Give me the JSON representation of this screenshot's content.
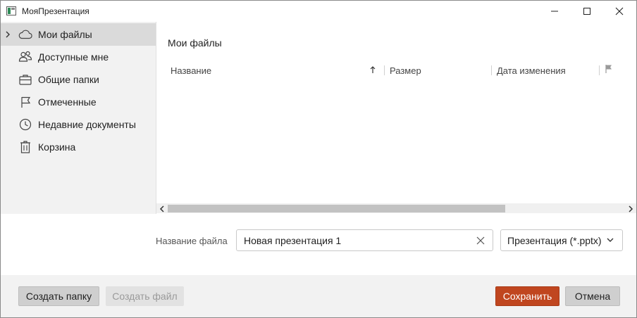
{
  "window": {
    "title": "МояПрезентация",
    "icons": {
      "app": "window-app-icon",
      "minimize": "minimize-icon",
      "maximize": "maximize-icon",
      "close": "close-icon"
    }
  },
  "sidebar": {
    "items": [
      {
        "label": "Мои файлы",
        "icon": "cloud-icon",
        "selected": true,
        "expandable": true
      },
      {
        "label": "Доступные мне",
        "icon": "people-icon",
        "selected": false
      },
      {
        "label": "Общие папки",
        "icon": "briefcase-icon",
        "selected": false
      },
      {
        "label": "Отмеченные",
        "icon": "flag-icon",
        "selected": false
      },
      {
        "label": "Недавние документы",
        "icon": "clock-icon",
        "selected": false
      },
      {
        "label": "Корзина",
        "icon": "trash-icon",
        "selected": false
      }
    ]
  },
  "main": {
    "title": "Мои файлы",
    "columns": [
      {
        "label": "Название",
        "sorted": "ascending"
      },
      {
        "label": "Размер"
      },
      {
        "label": "Дата изменения"
      },
      {
        "label": "",
        "icon": "flag-icon"
      }
    ],
    "rows": []
  },
  "scrollbar": {
    "position": 0
  },
  "file": {
    "name_label": "Название файла",
    "name_value": "Новая презентация 1",
    "type_value": "Презентация (*.pptx)"
  },
  "footer": {
    "create_folder": "Создать папку",
    "create_file": "Создать файл",
    "save": "Сохранить",
    "cancel": "Отмена"
  },
  "colors": {
    "accent": "#c0461f",
    "sidebar_bg": "#f2f2f2",
    "selected_bg": "#dadada"
  }
}
